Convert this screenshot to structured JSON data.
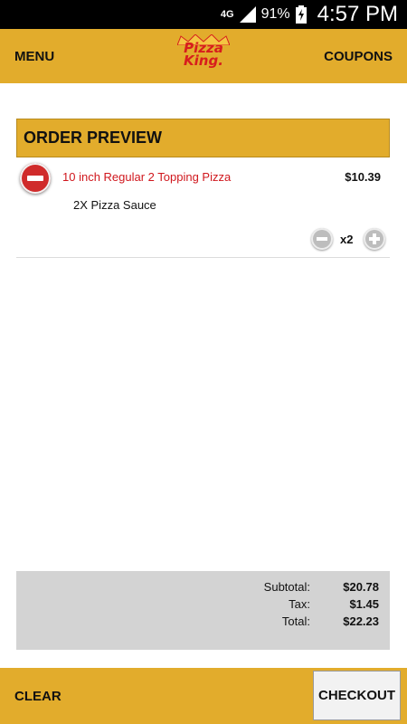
{
  "status_bar": {
    "network": "4G",
    "battery_percent": "91%",
    "time": "4:57 PM"
  },
  "header": {
    "menu_label": "MENU",
    "coupons_label": "COUPONS",
    "logo_line1": "Pizza",
    "logo_line2": "King."
  },
  "order": {
    "title": "ORDER PREVIEW",
    "items": [
      {
        "name": "10 inch Regular 2 Topping Pizza",
        "price": "$10.39",
        "modifier": "2X Pizza Sauce",
        "quantity": "x2"
      }
    ]
  },
  "totals": {
    "subtotal_label": "Subtotal:",
    "subtotal": "$20.78",
    "tax_label": "Tax:",
    "tax": "$1.45",
    "total_label": "Total:",
    "total": "$22.23"
  },
  "footer": {
    "clear_label": "CLEAR",
    "checkout_label": "CHECKOUT"
  },
  "colors": {
    "brand_gold": "#e2ac2c",
    "brand_red": "#d0171d"
  }
}
